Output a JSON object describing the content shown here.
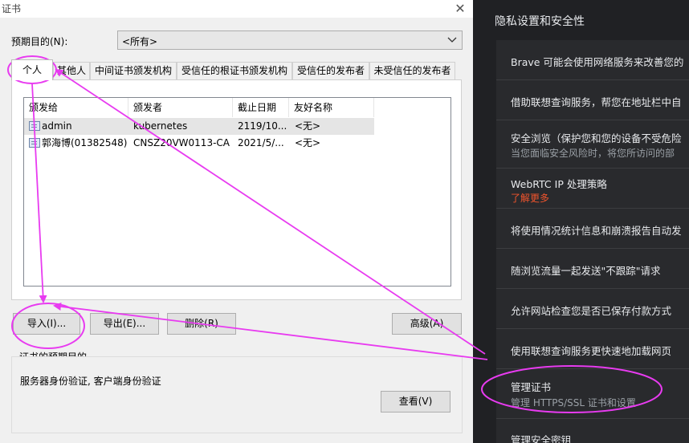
{
  "dialog": {
    "title": "证书",
    "close_glyph": "✕",
    "purpose_label": "预期目的(N):",
    "purpose_value": "<所有>",
    "tabs": [
      {
        "label": "个人"
      },
      {
        "label": "其他人"
      },
      {
        "label": "中间证书颁发机构"
      },
      {
        "label": "受信任的根证书颁发机构"
      },
      {
        "label": "受信任的发布者"
      },
      {
        "label": "未受信任的发布者"
      }
    ],
    "columns": [
      "颁发给",
      "颁发者",
      "截止日期",
      "友好名称"
    ],
    "rows": [
      {
        "issued_to": "admin",
        "issuer": "kubernetes",
        "expiry": "2119/10...",
        "friendly": "<无>"
      },
      {
        "issued_to": "郭海博(01382548)",
        "issuer": "CNSZ20VW0113-CA",
        "expiry": "2021/5/...",
        "friendly": "<无>"
      }
    ],
    "buttons": {
      "import": "导入(I)...",
      "export": "导出(E)...",
      "remove": "删除(R)",
      "advanced": "高级(A)",
      "view": "查看(V)"
    },
    "purposes_title": "证书的预期目的",
    "purposes_text": "服务器身份验证, 客户端身份验证"
  },
  "settings": {
    "header": "隐私设置和安全性",
    "items": [
      {
        "title": "Brave 可能会使用网络服务来改善您的"
      },
      {
        "title": "借助联想查询服务，帮您在地址栏中自"
      },
      {
        "title": "安全浏览（保护您和您的设备不受危险",
        "subtitle": "当您面临安全风险时，将您所访问的部"
      },
      {
        "title": "WebRTC IP 处理策略",
        "link": "了解更多"
      },
      {
        "title": "将使用情况统计信息和崩溃报告自动发"
      },
      {
        "title": "随浏览流量一起发送\"不跟踪\"请求"
      },
      {
        "title": "允许网站检查您是否已保存付款方式"
      },
      {
        "title": "使用联想查询服务更快速地加载网页"
      },
      {
        "title": "管理证书",
        "subtitle": "管理 HTTPS/SSL 证书和设置"
      },
      {
        "title": "管理安全密钥"
      }
    ]
  },
  "colors": {
    "annotation": "#e83bf0",
    "link": "#f0542d",
    "dark_bg": "#202124",
    "card_bg": "#292a2d"
  }
}
